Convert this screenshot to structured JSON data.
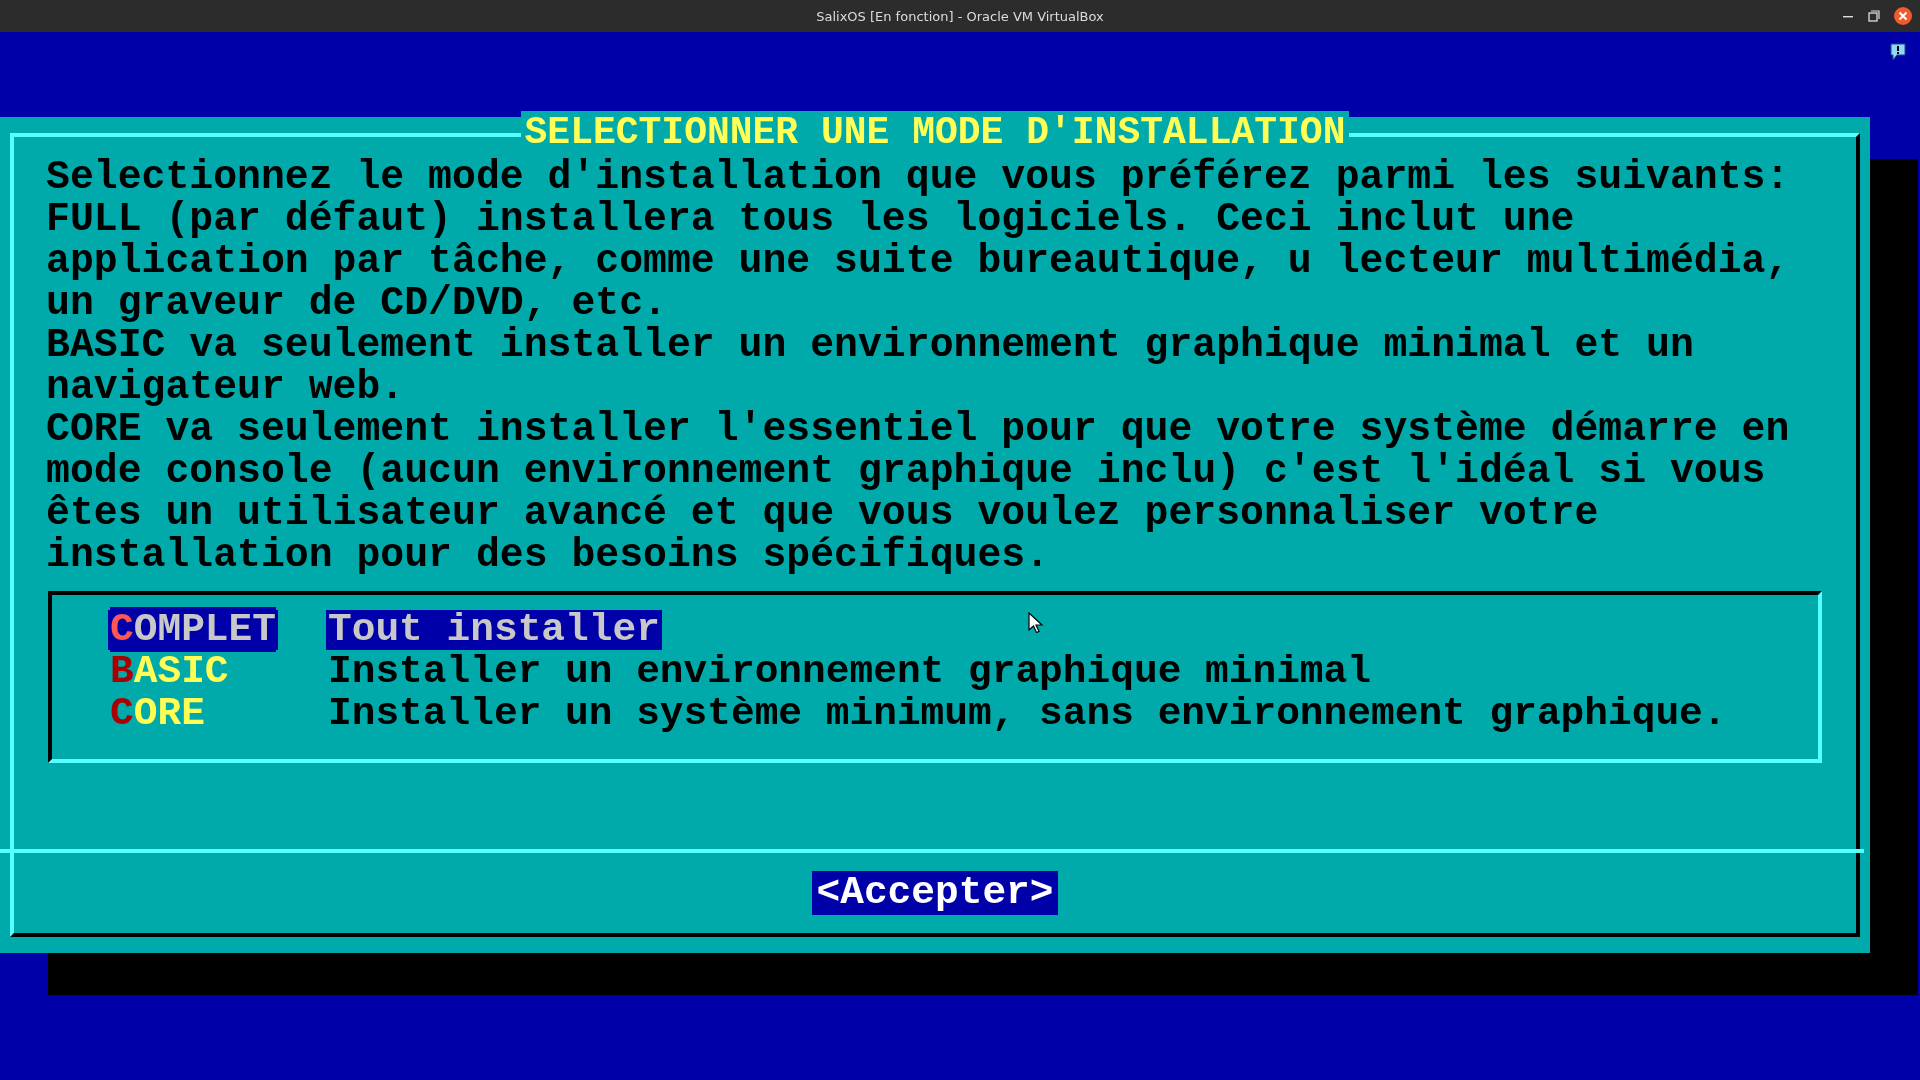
{
  "window": {
    "title": "SalixOS [En fonction] - Oracle VM VirtualBox"
  },
  "dialog": {
    "title": "SELECTIONNER UNE MODE D'INSTALLATION",
    "paragraphs": [
      {
        "lines": [
          "Selectionnez le mode d'installation que vous préférez parmi les suivants:"
        ]
      },
      {
        "lines": [
          "FULL (par défaut) installera tous les logiciels. Ceci inclut une",
          "application par tâche, comme une suite bureautique, u lecteur multimédia,",
          "un graveur de CD/DVD, etc."
        ]
      },
      {
        "lines": [
          "BASIC va seulement installer un environnement graphique minimal et un",
          "navigateur web."
        ]
      },
      {
        "lines": [
          "CORE va seulement installer l'essentiel pour que votre système démarre en",
          "mode console (aucun environnement graphique inclu) c'est l'idéal si vous",
          "êtes un utilisateur avancé et que vous voulez personnaliser votre",
          "installation pour des besoins spécifiques."
        ]
      }
    ],
    "options": [
      {
        "tag": "COMPLET",
        "description": "Tout installer",
        "selected": true
      },
      {
        "tag": "BASIC",
        "description": "Installer un environnement graphique minimal",
        "selected": false
      },
      {
        "tag": "CORE",
        "description": "Installer un système minimum, sans environnement graphique.",
        "selected": false
      }
    ],
    "button": "<Accepter>"
  }
}
